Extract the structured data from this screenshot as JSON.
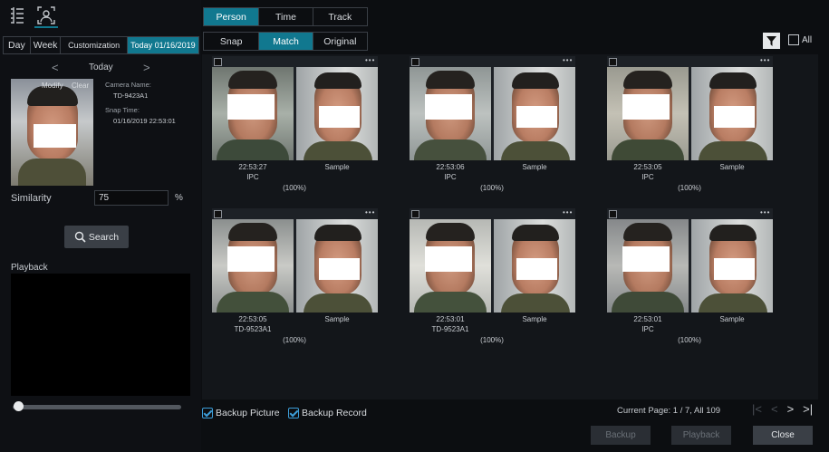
{
  "toolbar": {
    "list_icon": "list-view-icon",
    "face_icon": "face-search-icon"
  },
  "date_tabs": {
    "day": "Day",
    "week": "Week",
    "custom": "Customization",
    "today": "Today 01/16/2019"
  },
  "nav": {
    "prev": "<",
    "label": "Today",
    "next": ">"
  },
  "snap": {
    "modify": "Modify",
    "clear": "Clear",
    "camera_label": "Camera Name:",
    "camera_value": "TD-9423A1",
    "time_label": "Snap Time:",
    "time_value": "01/16/2019 22:53:01"
  },
  "similarity": {
    "label": "Similarity",
    "value": "75",
    "unit": "%"
  },
  "search_label": "Search",
  "playback_label": "Playback",
  "main_tabs": {
    "person": "Person",
    "time": "Time",
    "track": "Track"
  },
  "sub_tabs": {
    "snap": "Snap",
    "match": "Match",
    "original": "Original"
  },
  "filter": {
    "all_label": "All"
  },
  "results": [
    {
      "time": "22:53:27",
      "source": "IPC",
      "sample": "Sample",
      "score": "(100%)"
    },
    {
      "time": "22:53:06",
      "source": "IPC",
      "sample": "Sample",
      "score": "(100%)"
    },
    {
      "time": "22:53:05",
      "source": "IPC",
      "sample": "Sample",
      "score": "(100%)"
    },
    {
      "time": "22:53:05",
      "source": "TD-9523A1",
      "sample": "Sample",
      "score": "(100%)"
    },
    {
      "time": "22:53:01",
      "source": "TD-9523A1",
      "sample": "Sample",
      "score": "(100%)"
    },
    {
      "time": "22:53:01",
      "source": "IPC",
      "sample": "Sample",
      "score": "(100%)"
    }
  ],
  "footer": {
    "backup_picture": "Backup Picture",
    "backup_record": "Backup Record",
    "page_info": "Current Page: 1 / 7, All 109",
    "backup": "Backup",
    "playback": "Playback",
    "close": "Close"
  },
  "colors": {
    "accent": "#11788f",
    "panel": "#13161a",
    "checkbox": "#3c9dd8"
  }
}
